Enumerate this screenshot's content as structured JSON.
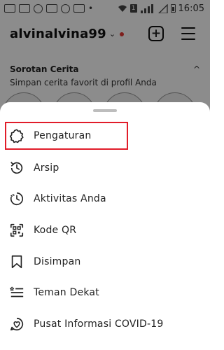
{
  "status_bar": {
    "time": "16:05",
    "sim_number": "1"
  },
  "profile": {
    "username": "alvinalvina99",
    "chevron": "⌄",
    "highlights_title": "Sorotan Cerita",
    "highlights_subtitle": "Simpan cerita favorit di profil Anda",
    "highlights_toggle": "^"
  },
  "sheet": {
    "items": [
      {
        "label": "Pengaturan",
        "icon": "gear-icon"
      },
      {
        "label": "Arsip",
        "icon": "archive-history-icon"
      },
      {
        "label": "Aktivitas Anda",
        "icon": "activity-clock-icon"
      },
      {
        "label": "Kode QR",
        "icon": "qr-code-icon"
      },
      {
        "label": "Disimpan",
        "icon": "bookmark-icon"
      },
      {
        "label": "Teman Dekat",
        "icon": "close-friends-list-icon"
      },
      {
        "label": "Pusat Informasi COVID-19",
        "icon": "covid-info-icon"
      }
    ]
  },
  "annotation": {
    "highlight_color": "#e11d2a"
  }
}
